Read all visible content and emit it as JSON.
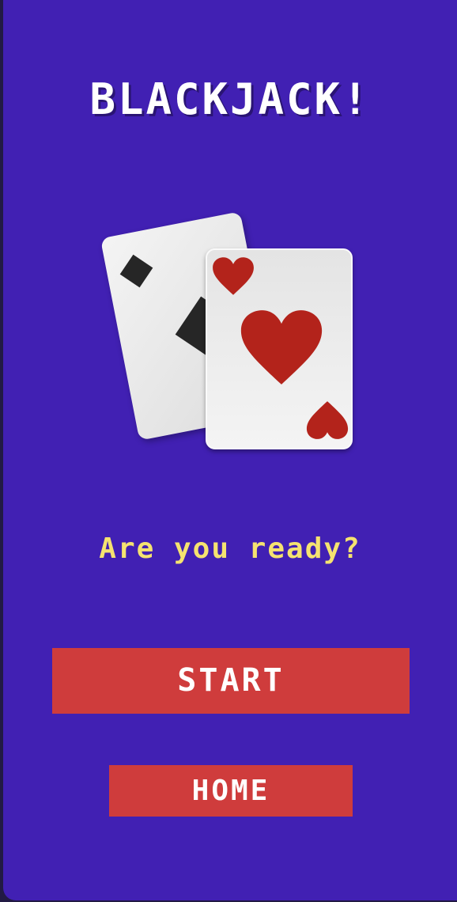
{
  "title": "BLACKJACK!",
  "prompt": "Are you ready?",
  "buttons": {
    "start_label": "START",
    "home_label": "HOME"
  },
  "illustration": {
    "back_card_suit": "spade",
    "front_card_suit": "heart"
  },
  "colors": {
    "background": "#4120b3",
    "title_text": "#ffffff",
    "prompt_text": "#f5e370",
    "button_bg": "#cf3c3c",
    "button_text": "#ffffff",
    "heart": "#b3231b",
    "spade": "#262626"
  },
  "icons": {
    "back_card": "playing-card-spade-icon",
    "front_card": "playing-card-heart-icon"
  }
}
